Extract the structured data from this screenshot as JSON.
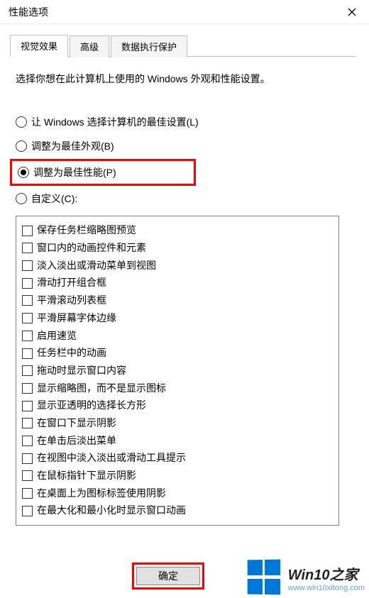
{
  "window": {
    "title": "性能选项",
    "close_label": "关闭"
  },
  "tabs": {
    "visual": "视觉效果",
    "advanced": "高级",
    "dep": "数据执行保护"
  },
  "description": "选择你想在此计算机上使用的 Windows 外观和性能设置。",
  "radios": {
    "let_windows": "让 Windows 选择计算机的最佳设置(L)",
    "best_appearance": "调整为最佳外观(B)",
    "best_performance": "调整为最佳性能(P)",
    "custom": "自定义(C):"
  },
  "checks": [
    "保存任务栏缩略图预览",
    "窗口内的动画控件和元素",
    "淡入淡出或滑动菜单到视图",
    "滑动打开组合框",
    "平滑滚动列表框",
    "平滑屏幕字体边缘",
    "启用速览",
    "任务栏中的动画",
    "拖动时显示窗口内容",
    "显示缩略图，而不是显示图标",
    "显示亚透明的选择长方形",
    "在窗口下显示阴影",
    "在单击后淡出菜单",
    "在视图中淡入淡出或滑动工具提示",
    "在鼠标指针下显示阴影",
    "在桌面上为图标标签使用阴影",
    "在最大化和最小化时显示窗口动画"
  ],
  "buttons": {
    "ok": "确定"
  },
  "watermark": {
    "brand": "Win10之家",
    "url": "www.win10xitong.com"
  }
}
